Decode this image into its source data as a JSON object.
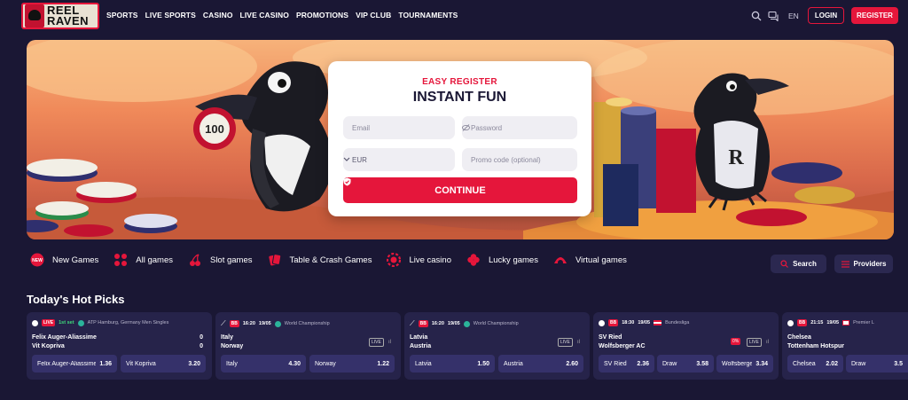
{
  "brand": {
    "line1": "REEL",
    "line2": "RAVEN"
  },
  "nav": [
    "SPORTS",
    "LIVE SPORTS",
    "CASINO",
    "LIVE CASINO",
    "PROMOTIONS",
    "VIP CLUB",
    "TOURNAMENTS"
  ],
  "header": {
    "lang": "EN",
    "login": "LOGIN",
    "register": "REGISTER"
  },
  "form": {
    "title_top": "EASY REGISTER",
    "title_main": "INSTANT FUN",
    "email_placeholder": "Email",
    "password_placeholder": "Password",
    "currency": "EUR",
    "promo_placeholder": "Promo code (optional)",
    "continue": "CONTINUE"
  },
  "hero": {
    "chip_label": "100"
  },
  "categories": [
    {
      "label": "New Games",
      "icon": "new-icon"
    },
    {
      "label": "All games",
      "icon": "grid-icon"
    },
    {
      "label": "Slot games",
      "icon": "cherry-icon"
    },
    {
      "label": "Table & Crash Games",
      "icon": "cards-icon"
    },
    {
      "label": "Live casino",
      "icon": "chip-icon"
    },
    {
      "label": "Lucky games",
      "icon": "clover-icon"
    },
    {
      "label": "Virtual games",
      "icon": "virtual-icon"
    }
  ],
  "search_label": "Search",
  "providers_label": "Providers",
  "hot_title": "Today's Hot Picks",
  "matches": [
    {
      "badge": "LIVE",
      "time": "1st set",
      "league": "ATP Hamburg, Germany Men Singles",
      "team1": "Felix Auger-Aliassime",
      "team2": "Vit Kopriva",
      "score1": "0",
      "score2": "0",
      "odds": [
        {
          "label": "Felix Auger-Aliassime",
          "value": "1.36"
        },
        {
          "label": "Vit Kopriva",
          "value": "3.20"
        }
      ]
    },
    {
      "badge": "BB",
      "time": "16:20",
      "date": "19/05",
      "league": "World Championship",
      "team1": "Italy",
      "team2": "Norway",
      "live": "LIVE",
      "odds": [
        {
          "label": "Italy",
          "value": "4.30"
        },
        {
          "label": "Norway",
          "value": "1.22"
        }
      ]
    },
    {
      "badge": "BB",
      "time": "16:20",
      "date": "19/05",
      "league": "World Championship",
      "team1": "Latvia",
      "team2": "Austria",
      "live": "LIVE",
      "odds": [
        {
          "label": "Latvia",
          "value": "1.50"
        },
        {
          "label": "Austria",
          "value": "2.60"
        }
      ]
    },
    {
      "badge": "BB",
      "time": "18:30",
      "date": "19/05",
      "league": "Bundesliga",
      "team1": "SV Ried",
      "team2": "Wolfsberger AC",
      "live": "LIVE",
      "pct": "0%",
      "odds": [
        {
          "label": "SV Ried",
          "value": "2.36"
        },
        {
          "label": "Draw",
          "value": "3.58"
        },
        {
          "label": "Wolfsberger",
          "value": "3.34"
        }
      ]
    },
    {
      "badge": "BB",
      "time": "21:15",
      "date": "19/05",
      "league": "Premier L",
      "team1": "Chelsea",
      "team2": "Tottenham Hotspur",
      "odds": [
        {
          "label": "Chelsea",
          "value": "2.02"
        },
        {
          "label": "Draw",
          "value": "3.5"
        }
      ]
    }
  ],
  "colors": {
    "accent": "#e5163b",
    "bg": "#1a1734",
    "card": "#26234a"
  }
}
